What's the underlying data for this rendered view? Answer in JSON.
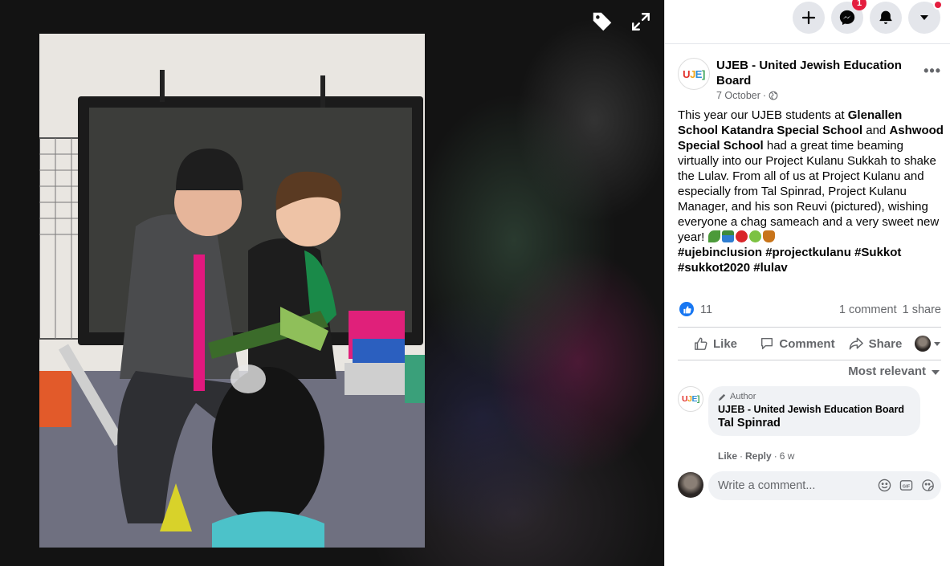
{
  "viewer": {
    "tag_icon": "tag-icon",
    "fullscreen_icon": "expand-icon"
  },
  "topbar": {
    "create_icon": "plus-icon",
    "messenger_icon": "messenger-icon",
    "messenger_badge": "1",
    "notifications_icon": "bell-icon",
    "account_icon": "caret-down-icon"
  },
  "post": {
    "page_logo_text": "UJE",
    "page_name": "UJEB - United Jewish Education Board",
    "date": "7 October",
    "separator": "·",
    "body": {
      "p1": "This year our UJEB students at ",
      "school1": "Glenallen School Katandra Special School",
      "p2": " and ",
      "school2": "Ashwood Special School",
      "p3": " had a great time beaming virtually into our Project Kulanu Sukkah to shake the Lulav. From all of us at Project Kulanu and especially from Tal Spinrad, Project Kulanu Manager, and his son Reuvi (pictured), wishing everyone a chag sameach and a very sweet new year! "
    },
    "hashtags": [
      "#ujebinclusion",
      "#projectkulanu",
      "#Sukkot",
      "#sukkot2020",
      "#lulav"
    ],
    "like_count": "11",
    "comment_count": "1 comment",
    "share_count": "1 share"
  },
  "actions": {
    "like": "Like",
    "comment": "Comment",
    "share": "Share"
  },
  "sort": {
    "label": "Most relevant"
  },
  "comment": {
    "author_tag": "Author",
    "name": "UJEB - United Jewish Education Board",
    "text": "Tal Spinrad",
    "like": "Like",
    "reply": "Reply",
    "time": "6 w",
    "separator": "·"
  },
  "composer": {
    "placeholder": "Write a comment..."
  },
  "colors": {
    "accent": "#1877f2",
    "badge": "#e41e3f",
    "secondary_text": "#65676b"
  }
}
